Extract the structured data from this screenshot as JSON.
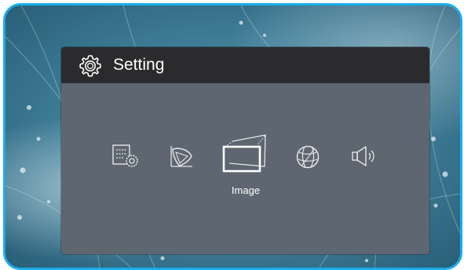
{
  "title_bar": {
    "icon": "gear-icon",
    "title": "Setting"
  },
  "menu": {
    "items": [
      {
        "icon": "display-settings-icon"
      },
      {
        "icon": "color-gamut-icon"
      },
      {
        "icon": "image-icon",
        "label": "Image",
        "selected": true
      },
      {
        "icon": "globe-icon"
      },
      {
        "icon": "speaker-icon"
      }
    ]
  },
  "colors": {
    "frame_border": "#19aee8",
    "title_bar": "#2b2b2d",
    "panel": "#5d6671",
    "text": "#ffffff"
  }
}
